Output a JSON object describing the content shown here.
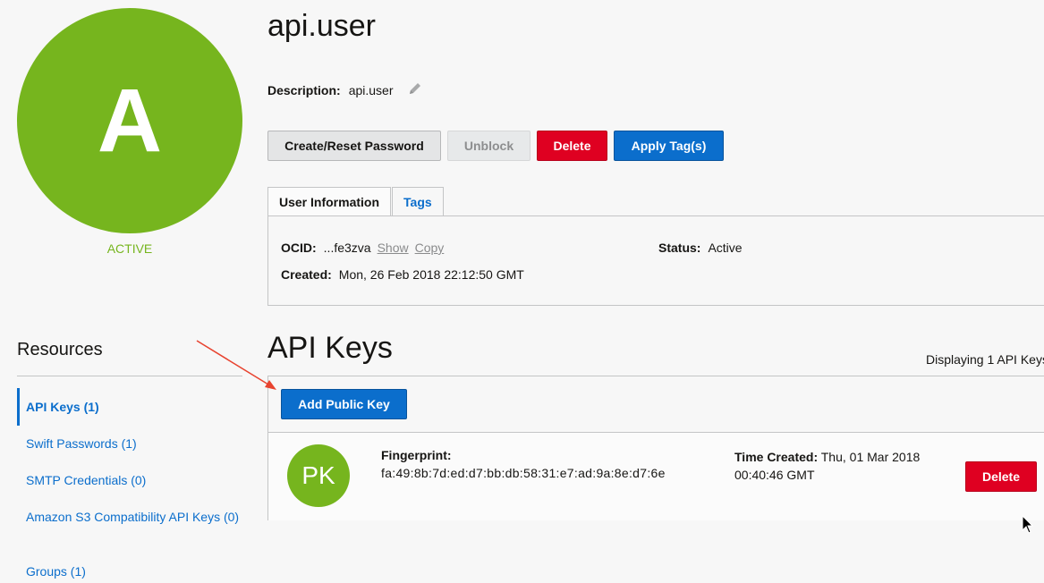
{
  "user": {
    "avatar_letter": "A",
    "status": "ACTIVE",
    "name": "api.user",
    "description_label": "Description:",
    "description_value": "api.user"
  },
  "actions": {
    "create_reset": "Create/Reset Password",
    "unblock": "Unblock",
    "delete": "Delete",
    "apply_tags": "Apply Tag(s)"
  },
  "tabs": [
    {
      "label": "User Information"
    },
    {
      "label": "Tags"
    }
  ],
  "user_info": {
    "ocid_label": "OCID:",
    "ocid_value": "...fe3zva",
    "show": "Show",
    "copy": "Copy",
    "created_label": "Created:",
    "created_value": "Mon, 26 Feb 2018 22:12:50 GMT",
    "status_label": "Status:",
    "status_value": "Active"
  },
  "resources": {
    "title": "Resources",
    "items": [
      {
        "label": "API Keys (1)"
      },
      {
        "label": "Swift Passwords (1)"
      },
      {
        "label": "SMTP Credentials (0)"
      },
      {
        "label": "Amazon S3 Compatibility API Keys (0)"
      },
      {
        "label": "Groups (1)"
      }
    ]
  },
  "api_keys": {
    "title": "API Keys",
    "displaying": "Displaying 1 API Keys",
    "add_button": "Add Public Key",
    "keys": [
      {
        "avatar": "PK",
        "fingerprint_label": "Fingerprint:",
        "fingerprint": "fa:49:8b:7d:ed:d7:bb:db:58:31:e7:ad:9a:8e:d7:6e",
        "time_created_label": "Time Created:",
        "time_created": "Thu, 01 Mar 2018 00:40:46 GMT",
        "delete": "Delete"
      }
    ]
  },
  "colors": {
    "active_green": "#76b51e",
    "link_blue": "#0b6ecc",
    "danger_red": "#df0021",
    "annotation_arrow": "#e8432f"
  },
  "icons": [
    "pencil-icon",
    "annotation-arrow",
    "mouse-cursor-icon"
  ]
}
